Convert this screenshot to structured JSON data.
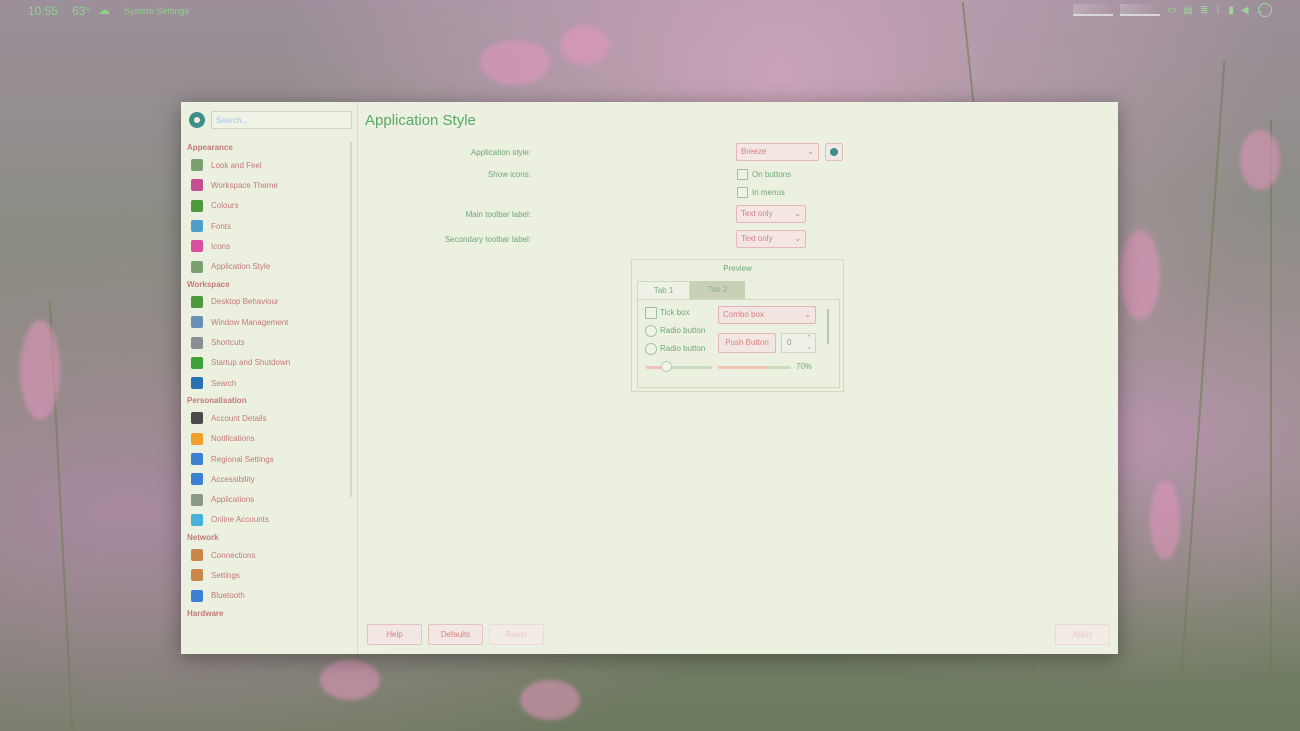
{
  "taskbar": {
    "clock": "10:55",
    "temperature": "63°",
    "weather_icon": "cloud-icon",
    "active_app": "System Settings"
  },
  "window": {
    "search_placeholder": "Search...",
    "sidebar": [
      {
        "category": "Appearance",
        "items": [
          {
            "label": "Look and Feel",
            "icon": "look-and-feel-icon",
            "color": "#7aa06f"
          },
          {
            "label": "Workspace Theme",
            "icon": "workspace-theme-icon",
            "color": "#c24f8f"
          },
          {
            "label": "Colours",
            "icon": "colours-icon",
            "color": "#4b9a3c"
          },
          {
            "label": "Fonts",
            "icon": "fonts-icon",
            "color": "#4c9fc9"
          },
          {
            "label": "Icons",
            "icon": "icons-icon",
            "color": "#d94fa0"
          },
          {
            "label": "Application Style",
            "icon": "application-style-icon",
            "color": "#7aa06f"
          }
        ]
      },
      {
        "category": "Workspace",
        "items": [
          {
            "label": "Desktop Behaviour",
            "icon": "desktop-behaviour-icon",
            "color": "#4b9a3c"
          },
          {
            "label": "Window Management",
            "icon": "window-management-icon",
            "color": "#6a8fb5"
          },
          {
            "label": "Shortcuts",
            "icon": "shortcuts-icon",
            "color": "#8a8f96"
          },
          {
            "label": "Startup and Shutdown",
            "icon": "startup-shutdown-icon",
            "color": "#3fa03a"
          },
          {
            "label": "Search",
            "icon": "search-icon",
            "color": "#2a6fb0"
          }
        ]
      },
      {
        "category": "Personalisation",
        "items": [
          {
            "label": "Account Details",
            "icon": "account-details-icon",
            "color": "#4a4a4a"
          },
          {
            "label": "Notifications",
            "icon": "notifications-icon",
            "color": "#f0a02a"
          },
          {
            "label": "Regional Settings",
            "icon": "regional-settings-icon",
            "color": "#3d7fd0"
          },
          {
            "label": "Accessibility",
            "icon": "accessibility-icon",
            "color": "#3d7fd0"
          },
          {
            "label": "Applications",
            "icon": "applications-icon",
            "color": "#8a9a86"
          },
          {
            "label": "Online Accounts",
            "icon": "online-accounts-icon",
            "color": "#4ab0d8"
          }
        ]
      },
      {
        "category": "Network",
        "items": [
          {
            "label": "Connections",
            "icon": "connections-icon",
            "color": "#c9874a"
          },
          {
            "label": "Settings",
            "icon": "network-settings-icon",
            "color": "#c9874a"
          },
          {
            "label": "Bluetooth",
            "icon": "bluetooth-icon",
            "color": "#3d7fd0"
          }
        ]
      },
      {
        "category": "Hardware",
        "items": []
      }
    ],
    "title": "Application Style",
    "form": {
      "app_style_label": "Application style:",
      "app_style_value": "Breeze",
      "show_icons_label": "Show icons:",
      "on_buttons": "On buttons",
      "in_menus": "In menus",
      "main_toolbar_label": "Main toolbar label:",
      "main_toolbar_value": "Text only",
      "secondary_toolbar_label": "Secondary toolbar label:",
      "secondary_toolbar_value": "Text only"
    },
    "preview": {
      "title": "Preview",
      "tab1": "Tab 1",
      "tab2": "Tab 2",
      "tick_box": "Tick box",
      "radio1": "Radio button",
      "radio2": "Radio button",
      "combo": "Combo box",
      "push_button": "Push Button",
      "spin_value": "0",
      "slider_fraction": 0.3,
      "progress_fraction": 0.7,
      "progress_label": "70%"
    },
    "footer": {
      "help": "Help",
      "defaults": "Defaults",
      "reset": "Reset",
      "apply": "Apply"
    }
  }
}
